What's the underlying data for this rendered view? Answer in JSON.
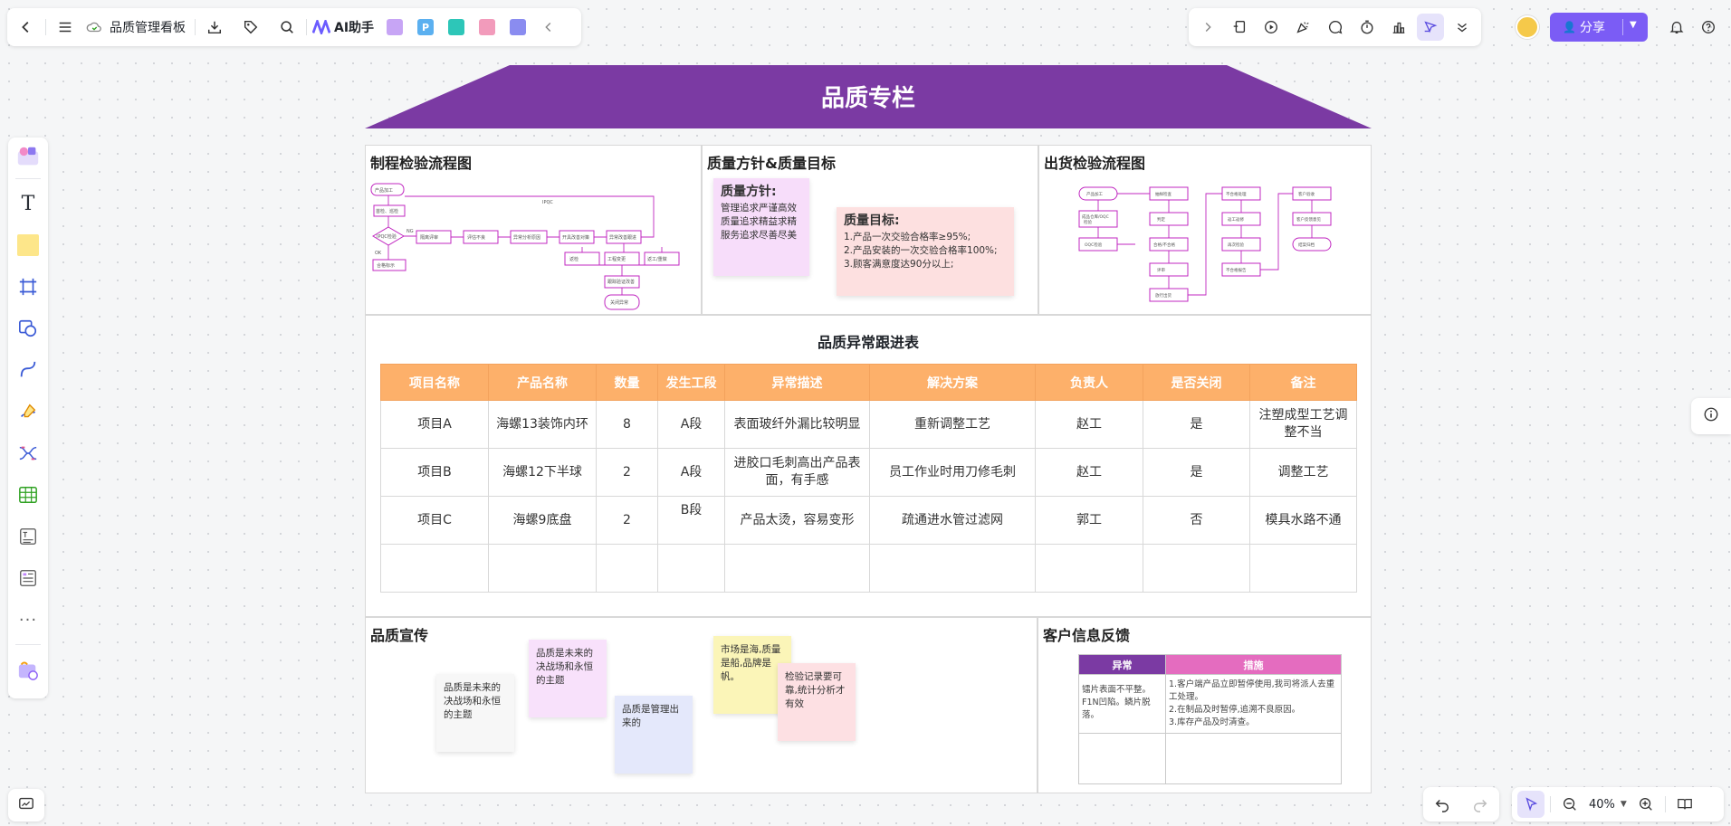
{
  "topbar": {
    "doc_title": "品质管理看板",
    "ai_label": "AI助手"
  },
  "share": {
    "label": "分享"
  },
  "board": {
    "banner_title": "品质专栏",
    "panels": {
      "process": {
        "title": "制程检验流程图"
      },
      "policy": {
        "title": "质量方针&质量目标",
        "policy_note_title": "质量方针:",
        "policy_note_text": "管理追求严谨高效质量追求精益求精服务追求尽善尽美",
        "goal_note_title": "质量目标:",
        "goal_lines": [
          "1.产品一次交验合格率≥95%;",
          "2.产品安装的一次交验合格率100%;",
          "3.顾客满意度达90分以上;"
        ]
      },
      "shipping": {
        "title": "出货检验流程图"
      },
      "promo": {
        "title": "品质宣传",
        "notes": [
          "品质是未来的决战场和永恒的主题",
          "品质是未来的决战场和永恒的主题",
          "品质是管理出来的",
          "市场是海,质量是船,品牌是帆。",
          "检验记录要可靠,统计分析才有效"
        ]
      },
      "feedback": {
        "title": "客户信息反馈",
        "headers": [
          "异常",
          "措施"
        ],
        "rows": [
          {
            "issue": "镭片表面不平整。F1N凹陷。鳞片脱落。",
            "measure": "1.客户端产品立即暂停使用,我司将派人去重工处理。\n2.在制品及时暂停,追溯不良原因。\n3.库存产品及时清查。"
          },
          {
            "issue": "",
            "measure": ""
          }
        ]
      }
    },
    "issues": {
      "title": "品质异常跟进表",
      "headers": [
        "项目名称",
        "产品名称",
        "数量",
        "发生工段",
        "异常描述",
        "解决方案",
        "负责人",
        "是否关闭",
        "备注"
      ],
      "rows": [
        [
          "项目A",
          "海螺13装饰内环",
          "8",
          "A段",
          "表面玻纤外漏比较明显",
          "重新调整工艺",
          "赵工",
          "是",
          "注塑成型工艺调整不当"
        ],
        [
          "项目B",
          "海螺12下半球",
          "2",
          "A段",
          "进胶口毛刺高出产品表面，有手感",
          "员工作业时用刀修毛刺",
          "赵工",
          "是",
          "调整工艺"
        ],
        [
          "项目C",
          "海螺9底盘",
          "2",
          "B段",
          "产品太烫，容易变形",
          "疏通进水管过滤网",
          "郭工",
          "否",
          "模具水路不通"
        ],
        [
          "",
          "",
          "",
          "",
          "",
          "",
          "",
          "",
          ""
        ]
      ]
    }
  },
  "zoom": {
    "level": "40%"
  },
  "colors": {
    "banner": "#7b3aa3",
    "accent": "#7b5cf5",
    "table_header": "#fdb06a"
  }
}
